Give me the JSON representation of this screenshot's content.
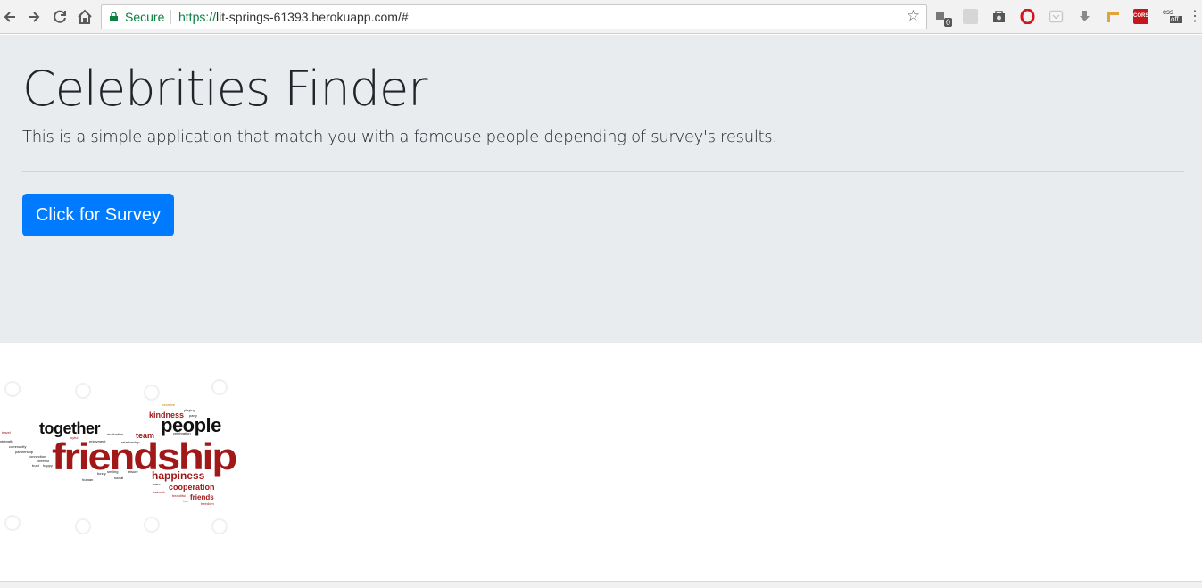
{
  "browser": {
    "secure_label": "Secure",
    "url_scheme": "https://",
    "url_host": "lit-springs-61393.herokuapp.com",
    "url_path": "/#",
    "ext_badge": "0",
    "ext_cors": "CORS",
    "ext_css_top": "css",
    "ext_css_bottom": "off"
  },
  "jumbotron": {
    "title": "Celebrities Finder",
    "lead": "This is a simple application that match you with a famouse people depending of survey's results.",
    "button_label": "Click for Survey"
  },
  "wordcloud": {
    "words": {
      "friendship": "friendship",
      "together": "together",
      "people": "people",
      "happiness": "happiness",
      "cooperation": "cooperation",
      "team": "team",
      "kindness": "kindness",
      "friends": "friends",
      "community": "community",
      "celebration": "celebration",
      "relationship": "relationship",
      "enjoyment": "enjoyment",
      "partnership": "partnership",
      "connection": "connection",
      "motivation": "motivation",
      "social": "social",
      "care": "care",
      "freedom": "freedom",
      "playing": "playing",
      "creative": "creative",
      "smiling": "smiling",
      "leisure": "leisure",
      "network": "network",
      "beautiful": "beautiful",
      "fun": "fun",
      "cheerful": "cheerful",
      "trust": "trust",
      "happy": "happy",
      "human": "human",
      "funny": "funny",
      "joyful": "joyful",
      "strength": "strength",
      "travel": "travel",
      "party": "party"
    },
    "colors": {
      "dark_red": "#a11818",
      "black": "#111111",
      "gold": "#b8860b"
    }
  }
}
